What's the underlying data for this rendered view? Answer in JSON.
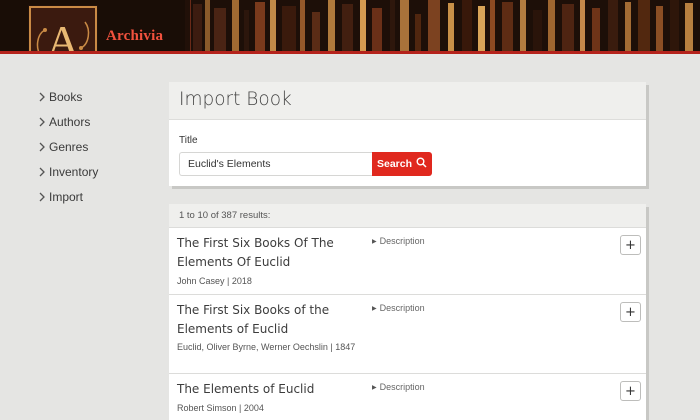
{
  "app": {
    "name": "Archivia",
    "logo_letter": "A"
  },
  "nav": [
    {
      "label": "Books"
    },
    {
      "label": "Authors"
    },
    {
      "label": "Genres"
    },
    {
      "label": "Inventory"
    },
    {
      "label": "Import"
    }
  ],
  "import": {
    "title": "Import Book",
    "field_label": "Title",
    "field_value": "Euclid's Elements",
    "search_label": "Search"
  },
  "results": {
    "summary": "1 to 10 of 387 results:",
    "items": [
      {
        "title": "The First Six Books Of The Elements Of Euclid",
        "meta": "John Casey | 2018",
        "desc_label": "Description",
        "add_label": "+"
      },
      {
        "title": "The First Six Books of the Elements of Euclid",
        "meta": "Euclid, Oliver Byrne, Werner Oechslin | 1847",
        "desc_label": "Description",
        "add_label": "+"
      },
      {
        "title": "The Elements of Euclid",
        "meta": "Robert Simson | 2004",
        "desc_label": "Description",
        "add_label": "+"
      }
    ]
  },
  "colors": {
    "accent": "#e0281e",
    "brand": "#f2523e",
    "header": "#1a0d07",
    "logo_gold": "#c98a45"
  },
  "icons": {
    "nav": "chevron-right-icon",
    "search": "search-icon",
    "add": "plus-icon",
    "description": "triangle-right-icon"
  }
}
